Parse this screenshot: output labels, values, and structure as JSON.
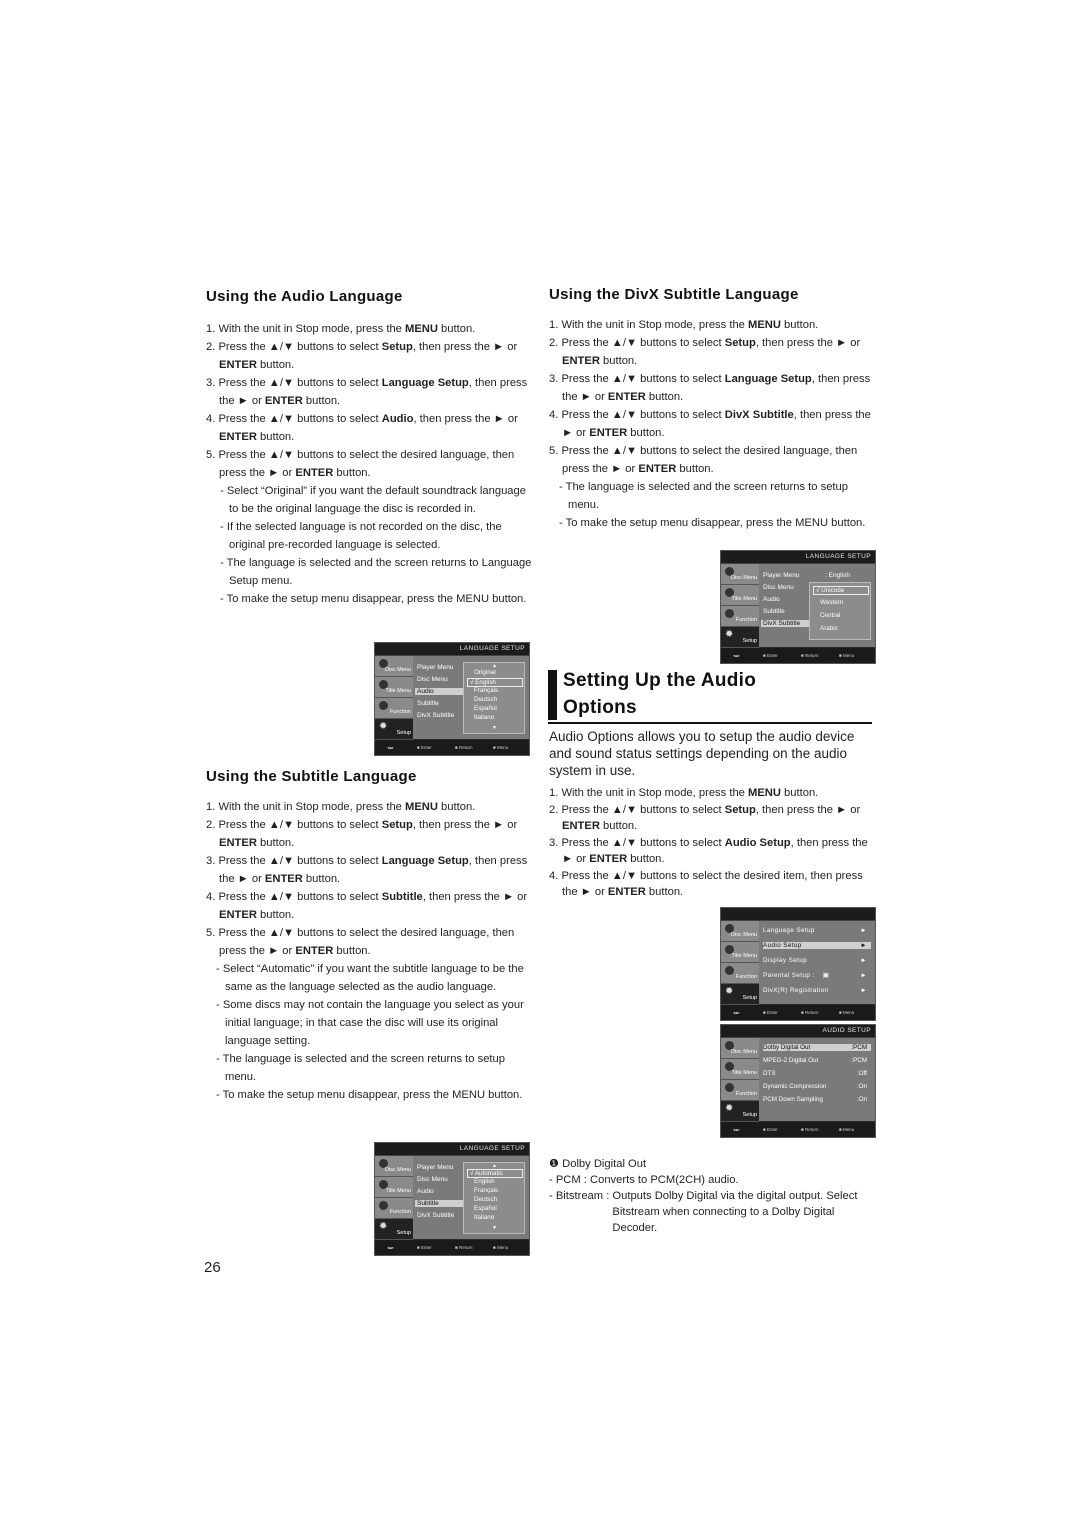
{
  "page_number": "26",
  "audio_language": {
    "title": "Using the Audio Language",
    "steps": [
      [
        "1. With the unit in Stop mode, press the ",
        "MENU",
        " button."
      ],
      [
        "2. Press the ▲/▼ buttons to select ",
        "Setup",
        ", then press the ► or ",
        "ENTER",
        " button."
      ],
      [
        "3. Press the ▲/▼ buttons to select ",
        "Language Setup",
        ", then press the ► or ",
        "ENTER",
        " button."
      ],
      [
        "4. Press the ▲/▼ buttons to select ",
        "Audio",
        ", then press the ► or ",
        "ENTER",
        " button."
      ],
      [
        "5. Press the ▲/▼ buttons to select the desired language, then press the ► or ",
        "ENTER",
        " button."
      ]
    ],
    "notes": [
      "- Select “Original” if you want the default soundtrack language to be the original language the disc is recorded in.",
      "- If the selected language is not recorded on the disc, the original pre-recorded language is selected.",
      "- The language is selected and the screen returns to Language Setup menu.",
      "- To make the setup menu disappear, press the MENU button."
    ],
    "osd": {
      "header": "LANGUAGE SETUP",
      "menu_items": [
        "Player Menu",
        "Disc Menu",
        "Audio",
        "Subtitle",
        "DivX Subtitle"
      ],
      "selected_item": "Audio",
      "options": [
        "Original",
        "English",
        "Français",
        "Deutsch",
        "Español",
        "Italiano"
      ],
      "checked_option": "English"
    }
  },
  "subtitle_language": {
    "title": "Using the Subtitle Language",
    "steps": [
      [
        "1. With the unit in Stop mode, press the ",
        "MENU",
        " button."
      ],
      [
        "2. Press the ▲/▼ buttons to select ",
        "Setup",
        ", then press the ► or ",
        "ENTER",
        " button."
      ],
      [
        "3. Press the ▲/▼ buttons to select ",
        "Language Setup",
        ", then press the ► or ",
        "ENTER",
        " button."
      ],
      [
        "4. Press the ▲/▼ buttons to select ",
        "Subtitle",
        ", then press the ► or ",
        "ENTER",
        " button."
      ],
      [
        "5. Press the ▲/▼ buttons to select the desired  language, then press the ► or ",
        "ENTER",
        " button."
      ]
    ],
    "notes": [
      "- Select “Automatic” if you want the subtitle  language to be the same as the language selected as the audio language.",
      "-  Some discs may not contain the language you select as your initial language; in that case the disc will use its original language setting.",
      "- The language is selected and the screen returns to setup menu.",
      "- To make the setup menu disappear, press the MENU button."
    ],
    "osd": {
      "header": "LANGUAGE SETUP",
      "menu_items": [
        "Player Menu",
        "Disc Menu",
        "Audio",
        "Subtitle",
        "DivX Subtitle"
      ],
      "selected_item": "Subtitle",
      "options": [
        "Automatic",
        "English",
        "Français",
        "Deutsch",
        "Español",
        "Italiano"
      ],
      "checked_option": "Automatic"
    }
  },
  "divx_subtitle_language": {
    "title": "Using the DivX Subtitle Language",
    "steps": [
      [
        "1. With the unit in Stop mode, press the ",
        "MENU",
        " button."
      ],
      [
        "2. Press the ▲/▼ buttons to select ",
        "Setup",
        ", then press the ► or ",
        "ENTER",
        " button."
      ],
      [
        "3. Press the ▲/▼ buttons to select ",
        "Language Setup",
        ", then press the ► or ",
        "ENTER",
        " button."
      ],
      [
        "4. Press the ▲/▼ buttons to select ",
        "DivX Subtitle",
        ", then press the ► or ",
        "ENTER",
        " button."
      ],
      [
        "5. Press the ▲/▼ buttons to select the desired  language, then press the ► or ",
        "ENTER",
        " button."
      ]
    ],
    "notes": [
      "- The language is selected and the screen returns to setup menu.",
      "- To make the setup menu disappear, press the MENU button."
    ],
    "osd": {
      "header": "LANGUAGE SETUP",
      "menu_items": [
        "Player Menu",
        "Disc Menu",
        "Audio",
        "Subtitle",
        "DivX Subtitle"
      ],
      "player_menu_value": ": English",
      "selected_item": "DivX Subtitle",
      "options": [
        "Unicode",
        "Western",
        "Central",
        "Arabic"
      ],
      "checked_option": "Unicode"
    }
  },
  "audio_options": {
    "title_line1": "Setting Up the Audio",
    "title_line2": "Options",
    "intro": "Audio Options allows you to setup the audio device and sound status settings depending on the audio system in use.",
    "steps": [
      [
        "1. With the unit in Stop mode, press the ",
        "MENU",
        " button."
      ],
      [
        "2. Press the ▲/▼ buttons to select ",
        "Setup",
        ", then press the ► or ",
        "ENTER",
        " button."
      ],
      [
        "3. Press the ▲/▼ buttons to select ",
        "Audio Setup",
        ", then press the ► or ",
        "ENTER",
        " button."
      ],
      [
        "4. Press the ▲/▼ buttons to select the desired item, then press the ► or ",
        "ENTER",
        " button."
      ]
    ],
    "setup_osd": {
      "rows": [
        "Language Setup",
        "Audio Setup",
        "Display Setup",
        "Parental Setup :",
        "DivX(R) Registration"
      ],
      "selected_row": "Audio Setup",
      "arrow": "►"
    },
    "audio_osd": {
      "header": "AUDIO SETUP",
      "rows": [
        {
          "label": "Dolby Digital Out",
          "value": ":PCM"
        },
        {
          "label": "MPEG-2 Digital Out",
          "value": ":PCM"
        },
        {
          "label": "DTS",
          "value": ":Off"
        },
        {
          "label": "Dynamic Compression",
          "value": ":On"
        },
        {
          "label": "PCM Down Sampling",
          "value": ":On"
        }
      ],
      "selected_row": "Dolby Digital Out"
    },
    "dolby_note": {
      "heading": "❶ Dolby Digital Out",
      "pcm": "- PCM : Converts to PCM(2CH) audio.",
      "bitstream_label": "- Bitstream : ",
      "bitstream_text": "Outputs Dolby Digital via the digital output. Select Bitstream when connecting to a Dolby Digital Decoder."
    }
  },
  "osd_common": {
    "side_tabs": [
      "Disc Menu",
      "Title Menu",
      "Function",
      "Setup"
    ],
    "footer": [
      "Enter",
      "Return",
      "Menu"
    ]
  }
}
